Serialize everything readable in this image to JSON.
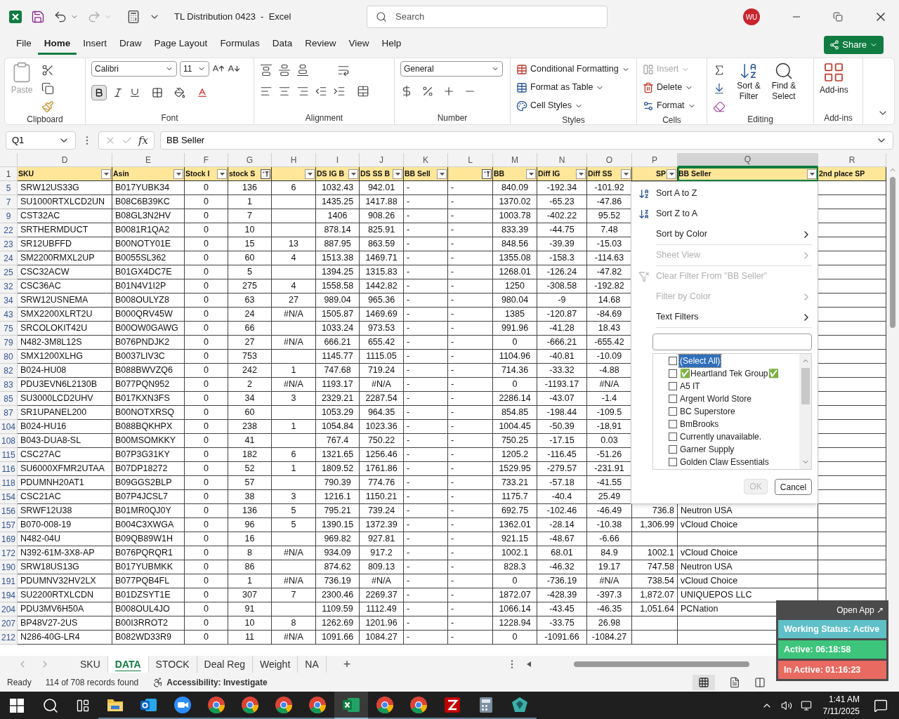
{
  "window": {
    "title": "TL Distribution 0423  -  Excel",
    "search_placeholder": "Search",
    "avatar": "WU"
  },
  "menu_tabs": [
    {
      "label": "File",
      "selected": false
    },
    {
      "label": "Home",
      "selected": true
    },
    {
      "label": "Insert",
      "selected": false
    },
    {
      "label": "Draw",
      "selected": false
    },
    {
      "label": "Page Layout",
      "selected": false
    },
    {
      "label": "Formulas",
      "selected": false
    },
    {
      "label": "Data",
      "selected": false
    },
    {
      "label": "Review",
      "selected": false
    },
    {
      "label": "View",
      "selected": false
    },
    {
      "label": "Help",
      "selected": false
    }
  ],
  "share": "Share",
  "ribbon": {
    "clipboard": {
      "label": "Clipboard",
      "paste": {
        "label": "Paste",
        "disabled": true
      }
    },
    "font": {
      "label": "Font",
      "family": "Calibri",
      "size": "11",
      "bold_pressed": true
    },
    "alignment": {
      "label": "Alignment"
    },
    "number": {
      "label": "Number",
      "format": "General"
    },
    "styles": {
      "label": "Styles",
      "items": [
        "Conditional Formatting",
        "Format as Table",
        "Cell Styles"
      ]
    },
    "cells": {
      "label": "Cells",
      "items": [
        {
          "label": "Insert",
          "disabled": true
        },
        {
          "label": "Delete",
          "disabled": false
        },
        {
          "label": "Format",
          "disabled": false
        }
      ]
    },
    "editing": {
      "label": "Editing",
      "items": [
        "Sort & Filter",
        "Find & Select"
      ]
    },
    "addins": {
      "label": "Add-ins",
      "button": "Add-ins"
    }
  },
  "formula_bar": {
    "name_box": "Q1",
    "fx": "fx",
    "value": "BB Seller"
  },
  "header_row_number": "1",
  "columns": [
    {
      "letter": "D",
      "header": "SKU",
      "filter_button": true,
      "filtered": false,
      "selected": false
    },
    {
      "letter": "E",
      "header": "Asin",
      "filter_button": true,
      "filtered": false,
      "selected": false
    },
    {
      "letter": "F",
      "header": "Stock I",
      "filter_button": true,
      "filtered": false,
      "selected": false
    },
    {
      "letter": "G",
      "header": "stock S",
      "filter_button": true,
      "filtered": true,
      "selected": false
    },
    {
      "letter": "H",
      "filter_button": true,
      "filtered": false,
      "selected": false
    },
    {
      "letter": "I",
      "header": "DS IG B",
      "filter_button": true,
      "filtered": false,
      "selected": false
    },
    {
      "letter": "J",
      "header": "DS SS B",
      "filter_button": true,
      "filtered": false,
      "selected": false
    },
    {
      "letter": "K",
      "header": "BB Sell",
      "filter_button": true,
      "filtered": false,
      "selected": false
    },
    {
      "letter": "L",
      "filter_button": true,
      "filtered": true,
      "selected": false
    },
    {
      "letter": "M",
      "header": "BB",
      "filter_button": true,
      "filtered": false,
      "selected": false
    },
    {
      "letter": "N",
      "header": "Diff IG",
      "filter_button": true,
      "filtered": false,
      "selected": false
    },
    {
      "letter": "O",
      "header": "Diff SS",
      "filter_button": true,
      "filtered": false,
      "selected": false
    },
    {
      "letter": "P",
      "header": "SP",
      "filter_button": true,
      "filtered": false,
      "selected": false
    },
    {
      "letter": "Q",
      "header": "BB Seller",
      "filter_button": true,
      "filtered": false,
      "selected": true
    },
    {
      "letter": "R",
      "header": "2nd place SP",
      "filter_button": false,
      "filtered": false,
      "selected": false
    }
  ],
  "rows": [
    {
      "n": "5",
      "D": "SRW12US33G",
      "E": "B017YUBK34",
      "F": "0",
      "G": "136",
      "H": "6",
      "I": "1032.43",
      "J": "942.01",
      "K": "-",
      "L": "-",
      "M": "840.09",
      "N": "-192.34",
      "O": "-101.92"
    },
    {
      "n": "7",
      "D": "SU1000RTXLCD2UN",
      "E": "B08C6B39KC",
      "F": "0",
      "G": "1",
      "I": "1435.25",
      "J": "1417.88",
      "K": "-",
      "L": "-",
      "M": "1370.02",
      "N": "-65.23",
      "O": "-47.86"
    },
    {
      "n": "9",
      "D": "CST32AC",
      "E": "B08GL3N2HV",
      "F": "0",
      "G": "7",
      "I": "1406",
      "J": "908.26",
      "K": "-",
      "L": "-",
      "M": "1003.78",
      "N": "-402.22",
      "O": "95.52"
    },
    {
      "n": "22",
      "D": "SRTHERMDUCT",
      "E": "B0081R1QA2",
      "F": "0",
      "G": "10",
      "I": "878.14",
      "J": "825.91",
      "K": "-",
      "L": "-",
      "M": "833.39",
      "N": "-44.75",
      "O": "7.48"
    },
    {
      "n": "23",
      "D": "SR12UBFFD",
      "E": "B00NOTY01E",
      "F": "0",
      "G": "15",
      "H": "13",
      "I": "887.95",
      "J": "863.59",
      "K": "-",
      "L": "-",
      "M": "848.56",
      "N": "-39.39",
      "O": "-15.03"
    },
    {
      "n": "24",
      "D": "SM2200RMXL2UP",
      "E": "B0055SL362",
      "F": "0",
      "G": "60",
      "H": "4",
      "I": "1513.38",
      "J": "1469.71",
      "K": "-",
      "L": "-",
      "M": "1355.08",
      "N": "-158.3",
      "O": "-114.63"
    },
    {
      "n": "25",
      "D": "CSC32ACW",
      "E": "B01GX4DC7E",
      "F": "0",
      "G": "5",
      "I": "1394.25",
      "J": "1315.83",
      "K": "-",
      "L": "-",
      "M": "1268.01",
      "N": "-126.24",
      "O": "-47.82"
    },
    {
      "n": "32",
      "D": "CSC36AC",
      "E": "B01N4V1I2P",
      "F": "0",
      "G": "275",
      "H": "4",
      "I": "1558.58",
      "J": "1442.82",
      "K": "-",
      "L": "-",
      "M": "1250",
      "N": "-308.58",
      "O": "-192.82"
    },
    {
      "n": "34",
      "D": "SRW12USNEMA",
      "E": "B008OULYZ8",
      "F": "0",
      "G": "63",
      "H": "27",
      "I": "989.04",
      "J": "965.36",
      "K": "-",
      "L": "-",
      "M": "980.04",
      "N": "-9",
      "O": "14.68"
    },
    {
      "n": "43",
      "D": "SMX2200XLRT2U",
      "E": "B000QRV45W",
      "F": "0",
      "G": "24",
      "H": "#N/A",
      "I": "1505.87",
      "J": "1469.69",
      "K": "-",
      "L": "-",
      "M": "1385",
      "N": "-120.87",
      "O": "-84.69"
    },
    {
      "n": "75",
      "D": "SRCOLOKIT42U",
      "E": "B00OW0GAWG",
      "F": "0",
      "G": "66",
      "I": "1033.24",
      "J": "973.53",
      "K": "-",
      "L": "-",
      "M": "991.96",
      "N": "-41.28",
      "O": "18.43"
    },
    {
      "n": "79",
      "D": "N482-3M8L12S",
      "E": "B076PNDJK2",
      "F": "0",
      "G": "27",
      "H": "#N/A",
      "I": "666.21",
      "J": "655.42",
      "K": "-",
      "L": "-",
      "M": "0",
      "N": "-666.21",
      "O": "-655.42"
    },
    {
      "n": "80",
      "D": "SMX1200XLHG",
      "E": "B0037LIV3C",
      "F": "0",
      "G": "753",
      "I": "1145.77",
      "J": "1115.05",
      "K": "-",
      "L": "-",
      "M": "1104.96",
      "N": "-40.81",
      "O": "-10.09"
    },
    {
      "n": "82",
      "D": "B024-HU08",
      "E": "B088BWVZQ6",
      "F": "0",
      "G": "242",
      "H": "1",
      "I": "747.68",
      "J": "719.24",
      "K": "-",
      "L": "-",
      "M": "714.36",
      "N": "-33.32",
      "O": "-4.88"
    },
    {
      "n": "83",
      "D": "PDU3EVN6L2130B",
      "E": "B077PQN952",
      "F": "0",
      "G": "2",
      "H": "#N/A",
      "I": "1193.17",
      "J": "#N/A",
      "K": "-",
      "L": "-",
      "M": "0",
      "N": "-1193.17",
      "O": "#N/A"
    },
    {
      "n": "85",
      "D": "SU3000LCD2UHV",
      "E": "B017KXN3FS",
      "F": "0",
      "G": "34",
      "H": "3",
      "I": "2329.21",
      "J": "2287.54",
      "K": "-",
      "L": "-",
      "M": "2286.14",
      "N": "-43.07",
      "O": "-1.4"
    },
    {
      "n": "87",
      "D": "SR1UPANEL200",
      "E": "B00NOTXRSQ",
      "F": "0",
      "G": "60",
      "I": "1053.29",
      "J": "964.35",
      "K": "-",
      "L": "-",
      "M": "854.85",
      "N": "-198.44",
      "O": "-109.5"
    },
    {
      "n": "104",
      "D": "B024-HU16",
      "E": "B088BQKHPX",
      "F": "0",
      "G": "238",
      "H": "1",
      "I": "1054.84",
      "J": "1023.36",
      "K": "-",
      "L": "-",
      "M": "1004.45",
      "N": "-50.39",
      "O": "-18.91"
    },
    {
      "n": "108",
      "D": "B043-DUA8-SL",
      "E": "B00MSOMKKY",
      "F": "0",
      "G": "41",
      "I": "767.4",
      "J": "750.22",
      "K": "-",
      "L": "-",
      "M": "750.25",
      "N": "-17.15",
      "O": "0.03"
    },
    {
      "n": "115",
      "D": "CSC27AC",
      "E": "B07P3G31KY",
      "F": "0",
      "G": "182",
      "H": "6",
      "I": "1321.65",
      "J": "1256.46",
      "K": "-",
      "L": "-",
      "M": "1205.2",
      "N": "-116.45",
      "O": "-51.26"
    },
    {
      "n": "116",
      "D": "SU6000XFMR2UTAA",
      "E": "B07DP18272",
      "F": "0",
      "G": "52",
      "H": "1",
      "I": "1809.52",
      "J": "1761.86",
      "K": "-",
      "L": "-",
      "M": "1529.95",
      "N": "-279.57",
      "O": "-231.91"
    },
    {
      "n": "118",
      "D": "PDUMNH20AT1",
      "E": "B09GGS2BLP",
      "F": "0",
      "G": "57",
      "I": "790.39",
      "J": "774.76",
      "K": "-",
      "L": "-",
      "M": "733.21",
      "N": "-57.18",
      "O": "-41.55"
    },
    {
      "n": "154",
      "D": "CSC21AC",
      "E": "B07P4JCSL7",
      "F": "0",
      "G": "38",
      "H": "3",
      "I": "1216.1",
      "J": "1150.21",
      "K": "-",
      "L": "-",
      "M": "1175.7",
      "N": "-40.4",
      "O": "25.49"
    },
    {
      "n": "156",
      "D": "SRWF12U38",
      "E": "B01MR0QJ0Y",
      "F": "0",
      "G": "136",
      "H": "5",
      "I": "795.21",
      "J": "739.24",
      "K": "-",
      "L": "-",
      "M": "692.75",
      "N": "-102.46",
      "O": "-46.49",
      "P": "736.8",
      "Q": "Neutron USA"
    },
    {
      "n": "157",
      "D": "B070-008-19",
      "E": "B004C3XWGA",
      "F": "0",
      "G": "96",
      "H": "5",
      "I": "1390.15",
      "J": "1372.39",
      "K": "-",
      "L": "-",
      "M": "1362.01",
      "N": "-28.14",
      "O": "-10.38",
      "P": "1,306.99",
      "Q": "vCloud Choice"
    },
    {
      "n": "169",
      "D": "N482-04U",
      "E": "B09QB89W1H",
      "F": "0",
      "G": "16",
      "I": "969.82",
      "J": "927.81",
      "K": "-",
      "L": "-",
      "M": "921.15",
      "N": "-48.67",
      "O": "-6.66"
    },
    {
      "n": "172",
      "D": "N392-61M-3X8-AP",
      "E": "B076PQRQR1",
      "F": "0",
      "G": "8",
      "H": "#N/A",
      "I": "934.09",
      "J": "917.2",
      "K": "-",
      "L": "-",
      "M": "1002.1",
      "N": "68.01",
      "O": "84.9",
      "P": "1002.1",
      "Q": "vCloud Choice"
    },
    {
      "n": "190",
      "D": "SRW18US13G",
      "E": "B017YUBMKK",
      "F": "0",
      "G": "86",
      "I": "874.62",
      "J": "809.13",
      "K": "-",
      "L": "-",
      "M": "828.3",
      "N": "-46.32",
      "O": "19.17",
      "P": "747.58",
      "Q": "Neutron USA"
    },
    {
      "n": "191",
      "D": "PDUMNV32HV2LX",
      "E": "B077PQB4FL",
      "F": "0",
      "G": "1",
      "H": "#N/A",
      "I": "736.19",
      "J": "#N/A",
      "K": "-",
      "L": "-",
      "M": "0",
      "N": "-736.19",
      "O": "#N/A",
      "P": "738.54",
      "Q": "vCloud Choice"
    },
    {
      "n": "194",
      "D": "SU2200RTXLCDN",
      "E": "B01DZSYT1E",
      "F": "0",
      "G": "307",
      "H": "7",
      "I": "2300.46",
      "J": "2269.37",
      "K": "-",
      "L": "-",
      "M": "1872.07",
      "N": "-428.39",
      "O": "-397.3",
      "P": "1,872.07",
      "Q": "UNIQUEPOS LLC"
    },
    {
      "n": "204",
      "D": "PDU3MV6H50A",
      "E": "B008OUL4JO",
      "F": "0",
      "G": "91",
      "I": "1109.59",
      "J": "1112.49",
      "K": "-",
      "L": "-",
      "M": "1066.14",
      "N": "-43.45",
      "O": "-46.35",
      "P": "1,051.64",
      "Q": "PCNation"
    },
    {
      "n": "207",
      "D": "BP48V27-2US",
      "E": "B00I3RROT2",
      "F": "0",
      "G": "10",
      "H": "8",
      "I": "1262.69",
      "J": "1201.96",
      "K": "-",
      "L": "-",
      "M": "1228.94",
      "N": "-33.75",
      "O": "26.98"
    },
    {
      "n": "212",
      "D": "N286-40G-LR4",
      "E": "B082WD33R9",
      "F": "0",
      "G": "11",
      "H": "#N/A",
      "I": "1091.66",
      "J": "1084.27",
      "K": "-",
      "L": "-",
      "M": "0",
      "N": "-1091.66",
      "O": "-1084.27"
    }
  ],
  "filter_menu": {
    "items": [
      {
        "label": "Sort A to Z",
        "kind": "sort_az",
        "disabled": false,
        "submenu": false
      },
      {
        "label": "Sort Z to A",
        "kind": "sort_za",
        "disabled": false,
        "submenu": false
      },
      {
        "label": "Sort by Color",
        "kind": "plain",
        "disabled": false,
        "submenu": true
      },
      {
        "label": "Sheet View",
        "kind": "plain",
        "disabled": true,
        "submenu": true
      },
      {
        "label": "Clear Filter From \"BB Seller\"",
        "kind": "clear",
        "disabled": true,
        "submenu": false
      },
      {
        "label": "Filter by Color",
        "kind": "plain",
        "disabled": true,
        "submenu": true
      },
      {
        "label": "Text Filters",
        "kind": "plain",
        "disabled": false,
        "submenu": true
      }
    ],
    "values": [
      {
        "label": "(Select All)",
        "checked": false,
        "selected": true
      },
      {
        "label": "✅Heartland Tek Group✅",
        "checked": false,
        "selected": false
      },
      {
        "label": "A5 IT",
        "checked": false,
        "selected": false
      },
      {
        "label": "Argent World Store",
        "checked": false,
        "selected": false
      },
      {
        "label": "BC Superstore",
        "checked": false,
        "selected": false
      },
      {
        "label": "BmBrooks",
        "checked": false,
        "selected": false
      },
      {
        "label": "Currently unavailable.",
        "checked": false,
        "selected": false
      },
      {
        "label": "Garner Supply",
        "checked": false,
        "selected": false
      },
      {
        "label": "Golden Claw Essentials",
        "checked": false,
        "selected": false
      }
    ],
    "ok": {
      "label": "OK",
      "disabled": true
    },
    "cancel": "Cancel"
  },
  "sheet_tabs": [
    {
      "label": "SKU",
      "selected": false
    },
    {
      "label": "DATA",
      "selected": true
    },
    {
      "label": "STOCK",
      "selected": false
    },
    {
      "label": "Deal Reg",
      "selected": false
    },
    {
      "label": "Weight",
      "selected": false
    },
    {
      "label": "NA",
      "selected": false
    }
  ],
  "add_sheet": "+",
  "status_bar": {
    "mode": "Ready",
    "records": "114 of 708 records found",
    "accessibility": "Accessibility: Investigate"
  },
  "tracker": {
    "open_app": "Open App ↗",
    "statuses": [
      {
        "label": "Working Status: Active",
        "color": "#5fc0c8"
      },
      {
        "label": "Active: 06:18:58",
        "color": "#3ec57c"
      },
      {
        "label": "In Active: 01:16:23",
        "color": "#e86a60"
      }
    ]
  },
  "taskbar": {
    "apps": [
      {
        "kind": "explorer",
        "active": false
      },
      {
        "kind": "outlook",
        "active": false
      },
      {
        "kind": "zoom",
        "active": false
      },
      {
        "kind": "chrome",
        "active": false
      },
      {
        "kind": "chrome",
        "active": false
      },
      {
        "kind": "chrome",
        "active": false
      },
      {
        "kind": "chrome",
        "active": false
      },
      {
        "kind": "excel",
        "active": true
      },
      {
        "kind": "chrome",
        "active": false
      },
      {
        "kind": "chrome",
        "active": false
      },
      {
        "kind": "filezilla",
        "active": false
      },
      {
        "kind": "calculator",
        "active": false
      },
      {
        "kind": "gem",
        "active": false
      }
    ],
    "time": "1:41 AM",
    "date": "7/11/2025"
  }
}
